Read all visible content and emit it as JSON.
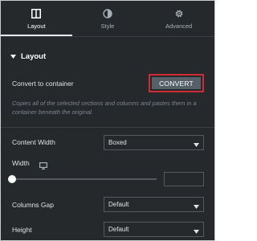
{
  "tabs": [
    {
      "label": "Layout",
      "icon": "layout-icon",
      "active": true
    },
    {
      "label": "Style",
      "icon": "style-half-circle-icon",
      "active": false
    },
    {
      "label": "Advanced",
      "icon": "gear-icon",
      "active": false
    }
  ],
  "section": {
    "title": "Layout",
    "caret_icon": "caret-down-icon"
  },
  "convert": {
    "label": "Convert to container",
    "button": "CONVERT",
    "description": "Copies all of the selected sections and columns and pastes them in a container beneath the original."
  },
  "content_width": {
    "label": "Content Width",
    "value": "Boxed"
  },
  "width": {
    "label": "Width",
    "device_icon": "desktop-monitor-icon",
    "value": "",
    "slider_fraction": 0
  },
  "columns_gap": {
    "label": "Columns Gap",
    "value": "Default"
  },
  "height": {
    "label": "Height",
    "value": "Default"
  },
  "colors": {
    "panel": "#26292c",
    "accent_border": "#d12b35",
    "button": "#556068"
  }
}
